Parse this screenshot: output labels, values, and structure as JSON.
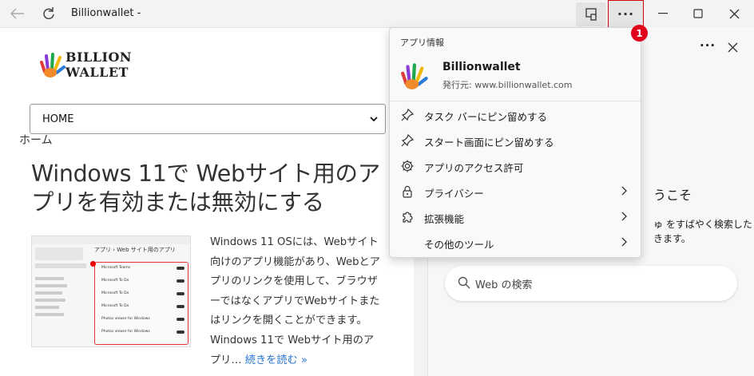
{
  "window": {
    "title": "Billionwallet -"
  },
  "page": {
    "logo_line1": "BILLION",
    "logo_line2": "WALLET",
    "select_value": "HOME",
    "breadcrumb": "ホーム",
    "headline": "Windows 11で Webサイト用のアプリを有効または無効にする",
    "excerpt": "Windows 11 OSには、Webサイト向けのアプリ機能があり、Webとアプリのリンクを使用して、ブラウザーではなくアプリでWebサイトまたはリンクを開くことができます。Windows 11で Webサイト用のアプリ…",
    "read_more": "続きを読む »",
    "thumb": {
      "title": "アプリ › Web サイト用のアプリ",
      "rows": [
        "Microsoft Teams",
        "Microsoft To Do",
        "Microsoft To Do",
        "Microsoft To Do",
        "Photos viewer for Windows",
        "Photos viewer for Windows"
      ]
    }
  },
  "sidebar": {
    "heading_fragment": "うこそ",
    "text_line1": "ゅ をすばやく検索した",
    "text_line2": "きます。",
    "search_placeholder": "Web の検索"
  },
  "menu": {
    "header": "アプリ情報",
    "app_name": "Billionwallet",
    "publisher": "発行元: www.billionwallet.com",
    "items": [
      {
        "label": "タスク バーにピン留めする",
        "icon": "pin-icon"
      },
      {
        "label": "スタート画面にピン留めする",
        "icon": "pin-icon"
      },
      {
        "label": "アプリのアクセス許可",
        "icon": "gear-icon"
      },
      {
        "label": "プライバシー",
        "icon": "lock-icon"
      },
      {
        "label": "拡張機能",
        "icon": "puzzle-icon"
      },
      {
        "label": "その他のツール",
        "icon": ""
      }
    ]
  },
  "callout": {
    "badge": "1"
  },
  "colors": {
    "badge": "#e0001b",
    "link": "#2a76d2"
  }
}
